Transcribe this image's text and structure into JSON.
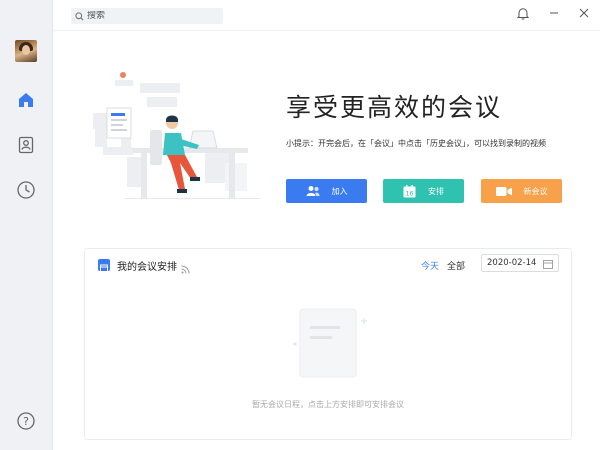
{
  "search": {
    "placeholder": "搜索"
  },
  "hero": {
    "title": "享受更高效的会议",
    "tip": "小提示：开完会后，在「会议」中点击「历史会议」，可以找到录制的视频"
  },
  "actions": [
    {
      "label": "加入",
      "icon": "join-person-icon",
      "color": "#3a7cf0"
    },
    {
      "label": "安排",
      "icon": "calendar-16-icon",
      "color": "#2fc2b0"
    },
    {
      "label": "新会议",
      "icon": "video-camera-icon",
      "color": "#f7a14a"
    }
  ],
  "panel": {
    "title": "我的会议安排",
    "tab_today": "今天",
    "tab_all": "全部",
    "date": "2020-02-14",
    "calendar_day": "16",
    "empty_text": "暂无会议日程，点击上方安排即可安排会议"
  },
  "colors": {
    "accent": "#3a7cf0",
    "teal": "#2fc2b0",
    "orange": "#f7a14a",
    "sidebar_bg": "#f0f1f4"
  }
}
